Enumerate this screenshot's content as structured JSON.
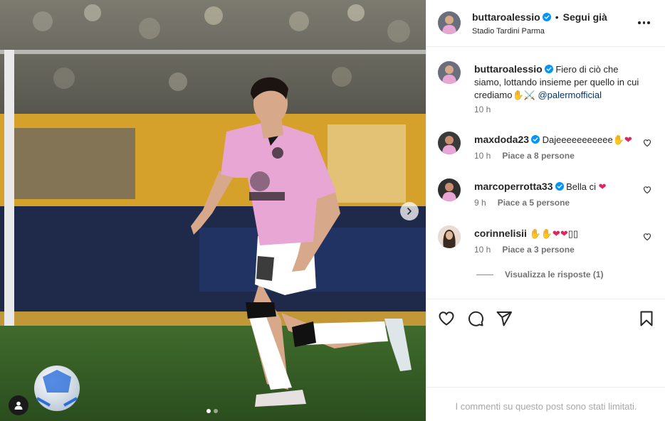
{
  "post": {
    "author": "buttaroalessio",
    "location": "Stadio Tardini Parma",
    "follow_label": "Segui già",
    "separator": "•",
    "carousel_index": 1,
    "carousel_total": 2
  },
  "caption": {
    "username": "buttaroalessio",
    "text": "Fiero di ciò che siamo, lottando insieme per quello in cui crediamo✋⚔️ ",
    "mention": "@palermofficial",
    "time": "10 h"
  },
  "comments": [
    {
      "username": "maxdoda23",
      "verified": true,
      "text": "Dajeeeeeeeeeee✋",
      "heart": "❤",
      "time": "10 h",
      "likes": "Piace a 8 persone"
    },
    {
      "username": "marcoperrotta33",
      "verified": true,
      "text": "Bella ci ",
      "heart": "❤",
      "time": "9 h",
      "likes": "Piace a 5 persone"
    },
    {
      "username": "corinnelisii",
      "verified": false,
      "text": "✋✋",
      "heart": "❤❤",
      "tail": "▯▯",
      "time": "10 h",
      "likes": "Piace a 3 persone"
    }
  ],
  "view_replies": "Visualizza le risposte (1)",
  "limited_text": "I commenti su questo post sono stati limitati.",
  "icons": {
    "like": "heart-icon",
    "comment": "comment-icon",
    "share": "share-icon",
    "save": "bookmark-icon",
    "more": "more-icon",
    "verified": "verified-badge-icon",
    "next": "chevron-right-icon",
    "tag": "user-tag-icon"
  },
  "colors": {
    "verified": "#0095f6",
    "heart": "#e0245e",
    "mention": "#00376b",
    "jersey": "#e7a6d3"
  }
}
